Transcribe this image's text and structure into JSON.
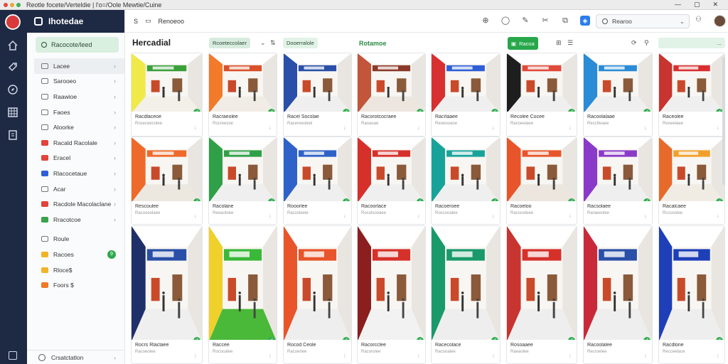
{
  "window": {
    "title": "Reotle focete/Verteldie | l'o=/Oole Mewtie/Cuine",
    "controls": [
      "—",
      "▢",
      "✕"
    ]
  },
  "sidebar": {
    "brand": "Ihotedae",
    "search_label": "Racocote/leed",
    "items": [
      {
        "label": "Lacee",
        "icon": "shield-icon",
        "color": "",
        "active": true
      },
      {
        "label": "Sarooeo",
        "icon": "tag-icon",
        "color": ""
      },
      {
        "label": "Raawioe",
        "icon": "list-icon",
        "color": ""
      },
      {
        "label": "Faoes",
        "icon": "grid-icon",
        "color": ""
      },
      {
        "label": "Aloorke",
        "icon": "star-icon",
        "color": ""
      },
      {
        "label": "Racald Racolale",
        "icon": "store-icon",
        "color": "red"
      },
      {
        "label": "Eracel",
        "icon": "store-icon",
        "color": "red"
      },
      {
        "label": "Rlacocetaue",
        "icon": "store-icon",
        "color": "blue"
      },
      {
        "label": "Acar",
        "icon": "store-icon",
        "color": ""
      },
      {
        "label": "Racdole Macolaclane",
        "icon": "store-icon",
        "color": "red"
      },
      {
        "label": "Rracotcoe",
        "icon": "store-icon",
        "color": "green"
      },
      {
        "label": "Roule",
        "icon": "store-icon",
        "color": ""
      },
      {
        "label": "Racoes",
        "icon": "store-icon",
        "color": "yellow",
        "badge": "9"
      },
      {
        "label": "Rloce$",
        "icon": "store-icon",
        "color": "yellow"
      },
      {
        "label": "Foors $",
        "icon": "store-icon",
        "color": "orange"
      }
    ],
    "footer_label": "Crsatctatlon"
  },
  "topbar": {
    "breadcrumb": "Renoeoo",
    "search_placeholder": "Rearoo",
    "actions": [
      "add-icon",
      "chat-icon",
      "pen-icon",
      "tools-icon",
      "layers-icon",
      "export-icon"
    ]
  },
  "filters": {
    "page_title": "Hercadial",
    "chip_1": "Rcoeteccolaer",
    "chip_2": "Dooerralole",
    "chip_3": "Rotamoe",
    "chip_4": "Racoa",
    "chip_5": "..."
  },
  "cards": [
    {
      "title": "Racdlaceoe",
      "sub": "Roseceecolee",
      "accent": "#3aa03a",
      "floor": "#f2f0e8",
      "wall": "#f0e94a"
    },
    {
      "title": "Racraeolee",
      "sub": "Rocreesoe",
      "accent": "#d9502a",
      "floor": "#f1ede6",
      "wall": "#f27a2a"
    },
    {
      "title": "Racel Socslae",
      "sub": "Racereeoleel",
      "accent": "#2a4fa8",
      "floor": "#efefef",
      "wall": "#2a4fa8"
    },
    {
      "title": "Racorotcocraee",
      "sub": "Raoaoae",
      "accent": "#8b3a2a",
      "floor": "#ece6df",
      "wall": "#c2553a"
    },
    {
      "title": "Racrlaaee",
      "sub": "Reoeooaoe",
      "accent": "#2e5fd6",
      "floor": "#efefef",
      "wall": "#d83030"
    },
    {
      "title": "Recolee Cocee",
      "sub": "Racoeelaee",
      "accent": "#e04a3a",
      "floor": "#efefef",
      "wall": "#1e1e1e"
    },
    {
      "title": "Racoolalaae",
      "sub": "Recctteaee",
      "accent": "#2a8bd6",
      "floor": "#efefef",
      "wall": "#2a8bd6"
    },
    {
      "title": "Raceolee",
      "sub": "Reoeelaee",
      "accent": "#d83030",
      "floor": "#efefef",
      "wall": "#c8342f"
    },
    {
      "title": "Rescoulee",
      "sub": "Racooeolaee",
      "accent": "#ee6a2a",
      "floor": "#ece8e0",
      "wall": "#ee6a2a"
    },
    {
      "title": "Racolane",
      "sub": "Reeaotoee",
      "accent": "#2fa048",
      "floor": "#efefef",
      "wall": "#2fa048"
    },
    {
      "title": "Rooorlee",
      "sub": "Racosleele",
      "accent": "#2e62c8",
      "floor": "#efefef",
      "wall": "#2e62c8"
    },
    {
      "title": "Racoorlace",
      "sub": "Rocolsooaee",
      "accent": "#d6302a",
      "floor": "#efefef",
      "wall": "#d6302a"
    },
    {
      "title": "Racoeroee",
      "sub": "Roccooalee",
      "accent": "#18a39a",
      "floor": "#efefef",
      "wall": "#18a39a"
    },
    {
      "title": "Racoeloo",
      "sub": "Racoceteee",
      "accent": "#e8552a",
      "floor": "#ece6df",
      "wall": "#e8552a"
    },
    {
      "title": "Racsolaee",
      "sub": "Raraeeolee",
      "accent": "#8a3ac8",
      "floor": "#efefef",
      "wall": "#8a3ac8"
    },
    {
      "title": "Racalcaee",
      "sub": "Rccooslee",
      "accent": "#f0a02a",
      "floor": "#f0ece4",
      "wall": "#e86a2a"
    },
    {
      "title": "Rocrs Rlaclaee",
      "sub": "Racoeolee",
      "accent": "#2a4fa8",
      "floor": "#efefef",
      "wall": "#1e2f6a"
    },
    {
      "title": "Raccee",
      "sub": "Rococalee",
      "accent": "#3ab838",
      "floor": "#4ab838",
      "wall": "#f0d02a"
    },
    {
      "title": "Rocod Ceole",
      "sub": "Racoerlee",
      "accent": "#e8552a",
      "floor": "#eeeeee",
      "wall": "#e8552a"
    },
    {
      "title": "Racorcclee",
      "sub": "Racorolee",
      "accent": "#d6302a",
      "floor": "#f2f2f2",
      "wall": "#8b1e1e"
    },
    {
      "title": "Racecolace",
      "sub": "Racooalee",
      "accent": "#1a9a6a",
      "floor": "#eeeeee",
      "wall": "#1a9a6a"
    },
    {
      "title": "Rosoaaee",
      "sub": "Raeaolee",
      "accent": "#d6302a",
      "floor": "#eeeeee",
      "wall": "#c8342f"
    },
    {
      "title": "Racoolalee",
      "sub": "Recroelee",
      "accent": "#2a4fa8",
      "floor": "#eeeeee",
      "wall": "#c82a3a"
    },
    {
      "title": "Racdlone",
      "sub": "Recceelace",
      "accent": "#1e3fb8",
      "floor": "#eeeeee",
      "wall": "#1e3fb8"
    }
  ]
}
